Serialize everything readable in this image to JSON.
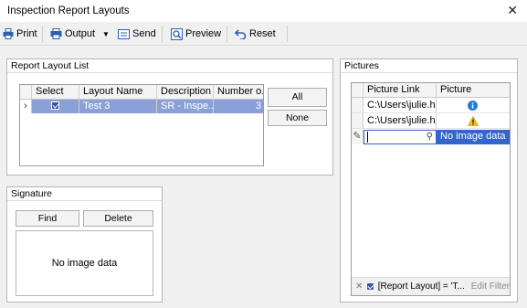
{
  "window": {
    "title": "Inspection Report Layouts"
  },
  "toolbar": {
    "print_label": "Print",
    "output_label": "Output",
    "send_label": "Send",
    "preview_label": "Preview",
    "reset_label": "Reset"
  },
  "layouts": {
    "group_title": "Report Layout List",
    "columns": [
      "Select",
      "Layout Name",
      "Description",
      "Number o..."
    ],
    "rows": [
      {
        "select": true,
        "name": "Test 3",
        "description": "SR - Inspe...",
        "number": "3"
      }
    ],
    "all_label": "All",
    "none_label": "None"
  },
  "signature": {
    "group_title": "Signature",
    "find_label": "Find",
    "delete_label": "Delete",
    "empty_text": "No image data"
  },
  "pictures": {
    "group_title": "Pictures",
    "columns": [
      "Picture Link",
      "Picture"
    ],
    "rows": [
      {
        "link": "C:\\Users\\julie.h...",
        "icon": "info-icon"
      },
      {
        "link": "C:\\Users\\julie.h...",
        "icon": "warning-icon"
      }
    ],
    "new_row_text": "No image data",
    "filter_text": "[Report Layout] = 'T...",
    "edit_filter_label": "Edit Filter"
  },
  "colors": {
    "selection": "#8ca0d8",
    "new_row": "#3465c8",
    "accent": "#2b5fb0"
  }
}
